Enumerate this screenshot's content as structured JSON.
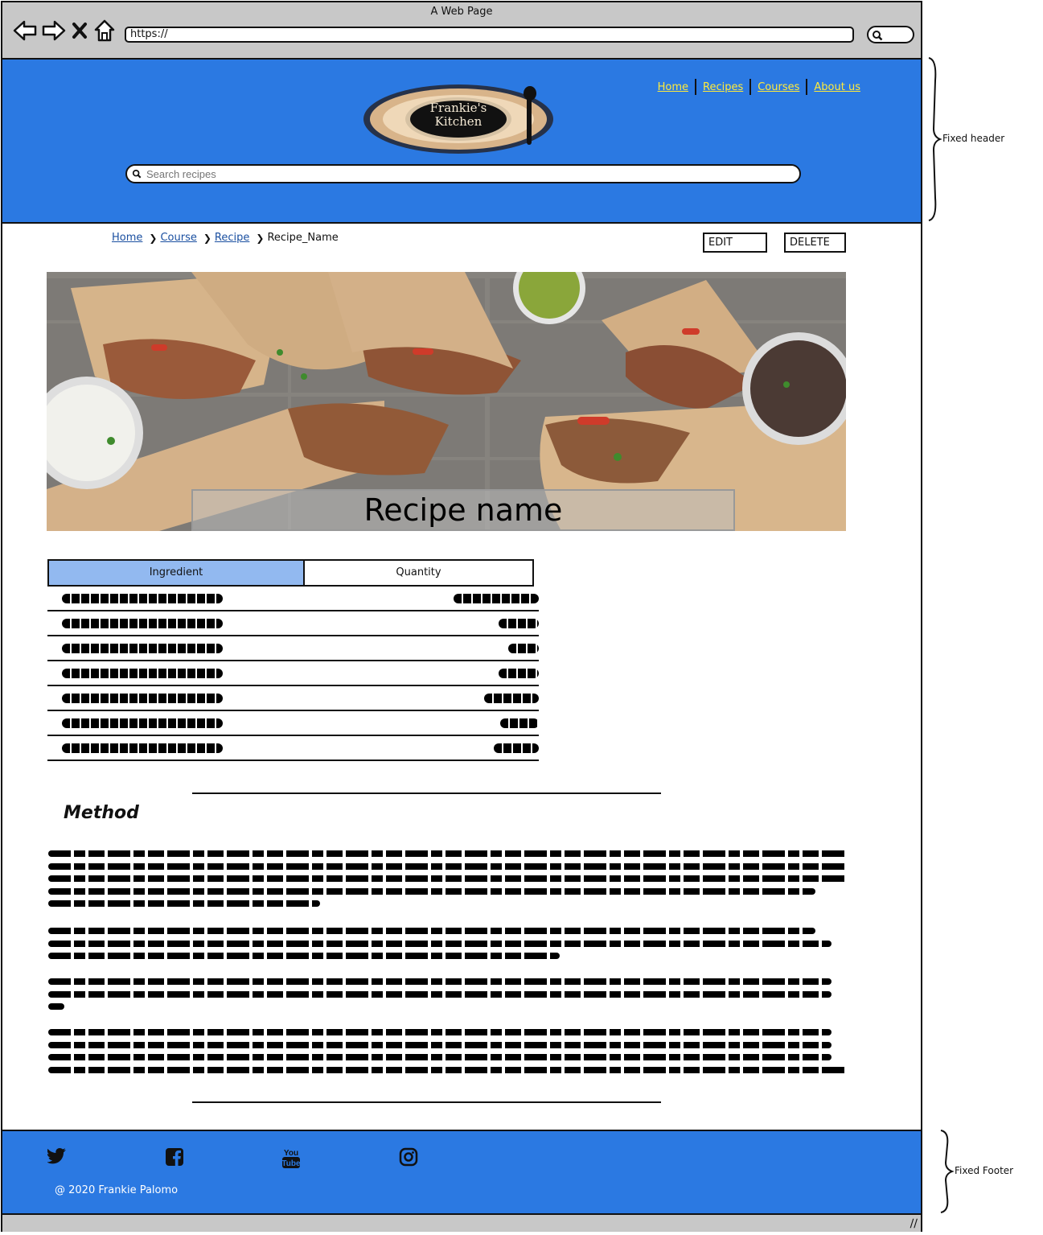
{
  "browser": {
    "window_title": "A Web Page",
    "url": "https://"
  },
  "header": {
    "logo_line1": "Frankie's",
    "logo_line2": "Kitchen",
    "nav": [
      {
        "label": "Home"
      },
      {
        "label": "Recipes"
      },
      {
        "label": "Courses"
      },
      {
        "label": "About us"
      }
    ],
    "search_placeholder": "Search recipes"
  },
  "breadcrumb": {
    "items": [
      "Home",
      "Course",
      "Recipe"
    ],
    "current": "Recipe_Name"
  },
  "actions": {
    "edit_label": "EDIT",
    "delete_label": "DELETE"
  },
  "hero": {
    "title": "Recipe name"
  },
  "ingredients": {
    "headers": [
      "Ingredient",
      "Quantity"
    ],
    "row_count": 7
  },
  "method": {
    "title": "Method"
  },
  "footer": {
    "icons": [
      "twitter-icon",
      "facebook-icon",
      "youtube-icon",
      "instagram-icon"
    ],
    "youtube_text": "You Tube",
    "copyright": "@ 2020 Frankie Palomo"
  },
  "annotations": {
    "header": "Fixed header",
    "footer": "Fixed Footer"
  },
  "colors": {
    "brand_blue": "#2b79e2",
    "nav_link": "#ffeb3b",
    "table_header": "#92b9f0",
    "chrome_gray": "#c8c8c8"
  }
}
